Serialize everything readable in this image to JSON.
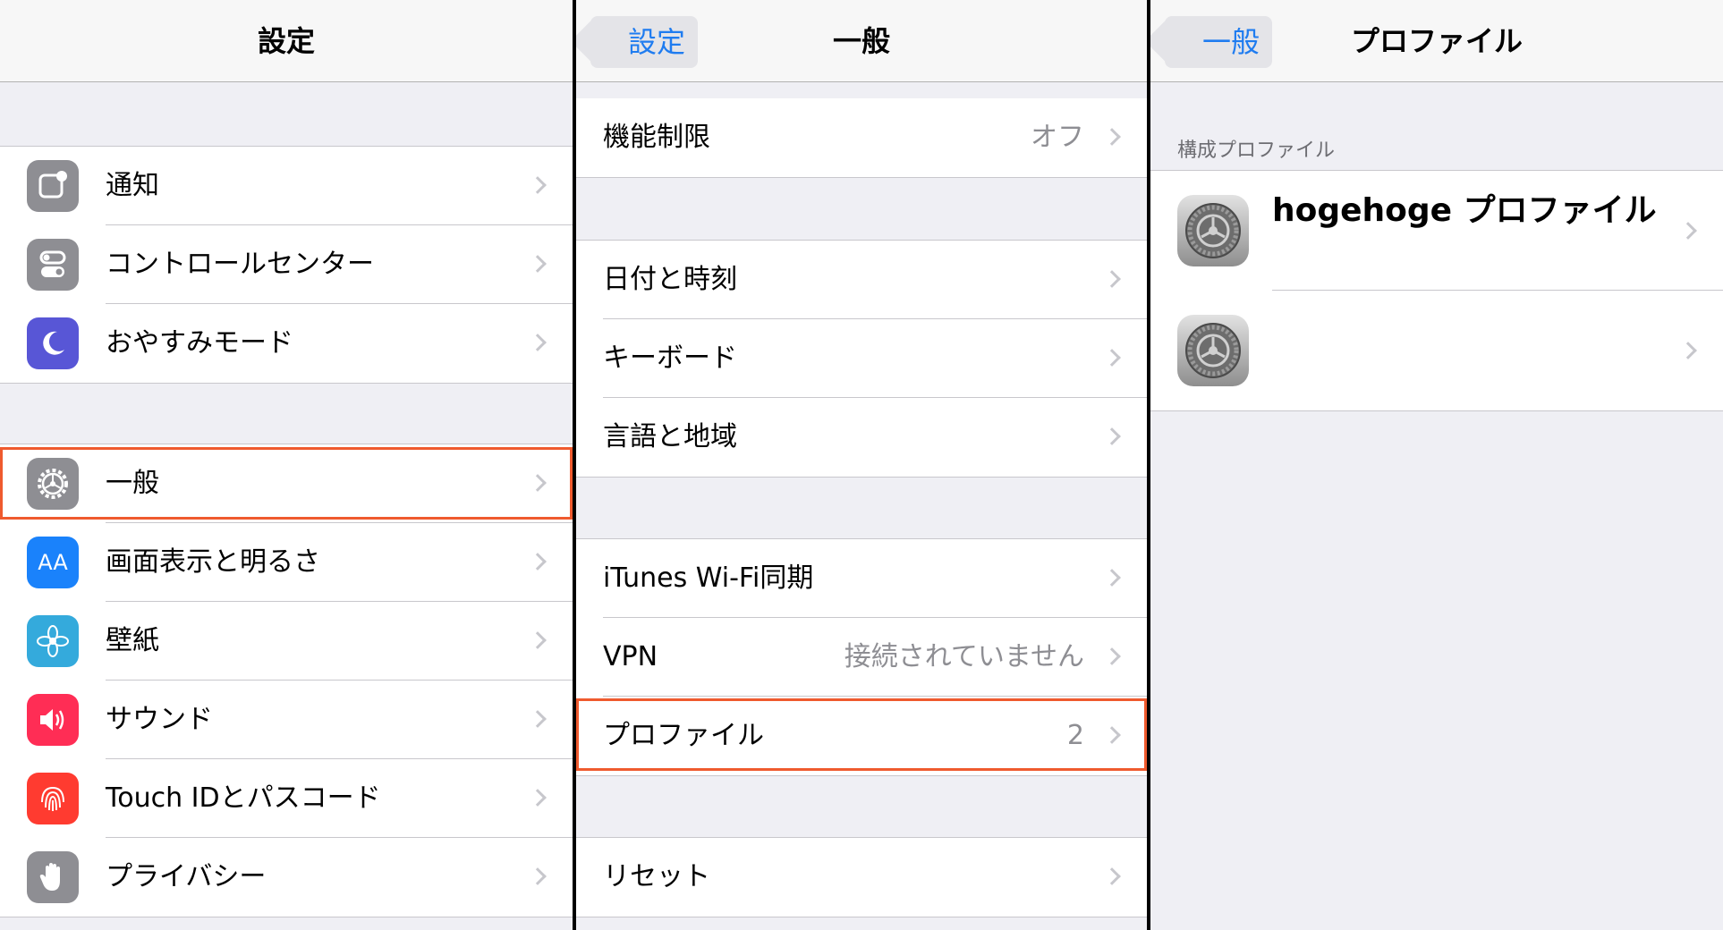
{
  "panel1": {
    "title": "設定",
    "group1": [
      {
        "label": "通知",
        "icon": "notifications-icon",
        "color": "#8e8e93"
      },
      {
        "label": "コントロールセンター",
        "icon": "control-center-icon",
        "color": "#8e8e93"
      },
      {
        "label": "おやすみモード",
        "icon": "moon-icon",
        "color": "#5856d6"
      }
    ],
    "group2": [
      {
        "label": "一般",
        "icon": "gear-icon",
        "color": "#8e8e93",
        "highlighted": true
      },
      {
        "label": "画面表示と明るさ",
        "icon": "display-icon",
        "icon_text": "AA",
        "color": "#1a82fb"
      },
      {
        "label": "壁紙",
        "icon": "wallpaper-icon",
        "color": "#34aadc"
      },
      {
        "label": "サウンド",
        "icon": "speaker-icon",
        "color": "#ff2d55"
      },
      {
        "label": "Touch IDとパスコード",
        "icon": "fingerprint-icon",
        "color": "#ff3b30"
      },
      {
        "label": "プライバシー",
        "icon": "hand-icon",
        "color": "#8e8e93"
      }
    ]
  },
  "panel2": {
    "back": "設定",
    "title": "一般",
    "restrictions": {
      "label": "機能制限",
      "value": "オフ"
    },
    "group_b": [
      "日付と時刻",
      "キーボード",
      "言語と地域"
    ],
    "group_c": [
      {
        "label": "iTunes Wi-Fi同期",
        "value": ""
      },
      {
        "label": "VPN",
        "value": "接続されていません"
      },
      {
        "label": "プロファイル",
        "value": "2",
        "highlighted": true
      }
    ],
    "reset": "リセット"
  },
  "panel3": {
    "back": "一般",
    "title": "プロファイル",
    "section": "構成プロファイル",
    "profiles": [
      {
        "name": "hogehoge プロファイル",
        "icon": "settings-gear-icon"
      },
      {
        "name": "",
        "icon": "settings-gear-icon"
      }
    ]
  },
  "colors": {
    "accent": "#1f7cf0",
    "highlight": "#ef5a2e"
  }
}
